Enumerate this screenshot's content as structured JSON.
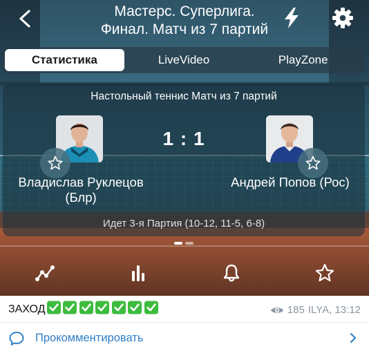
{
  "header": {
    "title_line1": "Мастерс. Суперлига.",
    "title_line2": "Финал. Матч из 7 партий"
  },
  "tabs": [
    {
      "label": "Статистика",
      "active": true
    },
    {
      "label": "LiveVideo",
      "active": false
    },
    {
      "label": "PlayZone",
      "active": false
    }
  ],
  "match": {
    "type": "Настольный теннис Матч из 7 партий",
    "score": "1 : 1",
    "player1": {
      "name": "Владислав Руклецов (Блр)"
    },
    "player2": {
      "name": "Андрей Попов (Рос)"
    },
    "status": "Идет 3-я Партия (10-12, 11-5, 6-8)"
  },
  "pager": {
    "pages": 2,
    "active": 1
  },
  "actions": [
    "chart-icon",
    "stats-bars-icon",
    "bell-icon",
    "star-icon"
  ],
  "message": {
    "text": "ЗАХОД",
    "checks": 7,
    "views": "185",
    "author_time": "ILYA, 13:12"
  },
  "comment": {
    "label": "Прокомментировать"
  },
  "colors": {
    "accent": "#2f7fc7",
    "check": "#3dbb3d",
    "meta": "#8a97a3"
  }
}
